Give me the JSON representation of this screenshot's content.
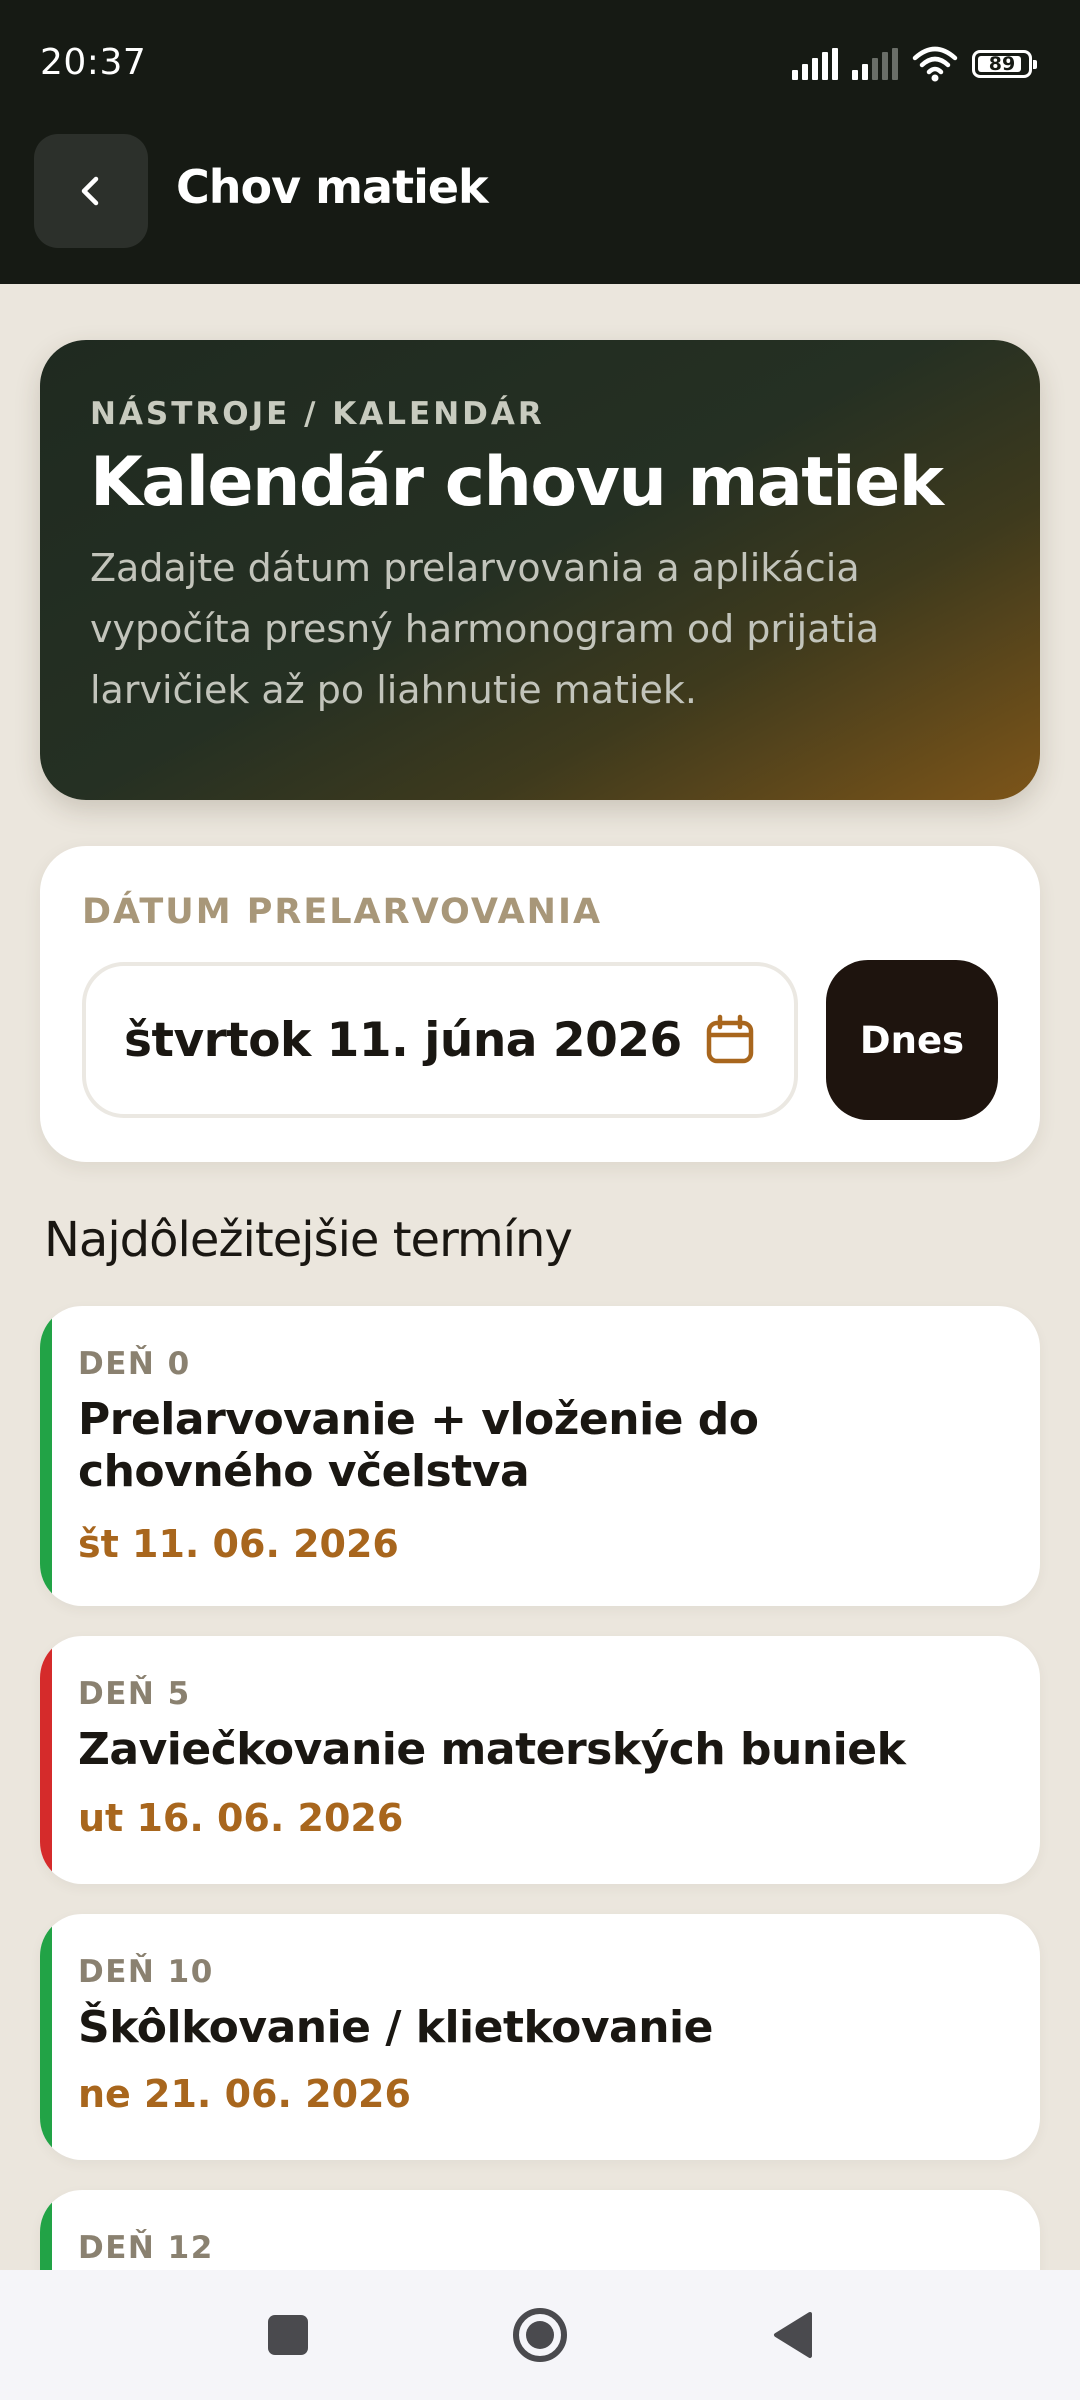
{
  "status_bar": {
    "time": "20:37",
    "battery": "89"
  },
  "app_bar": {
    "title": "Chov matiek"
  },
  "hero": {
    "eyebrow": "NÁSTROJE / KALENDÁR",
    "title": "Kalendár chovu matiek",
    "description": "Zadajte dátum prelarvovania a aplikácia vypočíta presný harmonogram od prijatia larvičiek až po liahnutie matiek."
  },
  "date_picker": {
    "label": "DÁTUM PRELARVOVANIA",
    "value": "štvrtok 11. júna 2026",
    "today_label": "Dnes"
  },
  "section_title": "Najdôležitejšie termíny",
  "events": [
    {
      "day": "DEŇ 0",
      "name": "Prelarvovanie + vloženie do chovného včelstva",
      "date": "št 11. 06. 2026",
      "color": "#22a346"
    },
    {
      "day": "DEŇ 5",
      "name": "Zaviečkovanie materských buniek",
      "date": "ut 16. 06. 2026",
      "color": "#d52b2b"
    },
    {
      "day": "DEŇ 10",
      "name": "Škôlkovanie / klietkovanie",
      "date": "ne 21. 06. 2026",
      "color": "#22a346"
    },
    {
      "day": "DEŇ 12",
      "color": "#22a346"
    }
  ],
  "colors": {
    "accent": "#a8661d",
    "dark": "#161a14",
    "background": "#ebe6dd"
  }
}
